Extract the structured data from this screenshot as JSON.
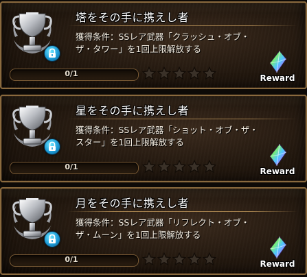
{
  "trophies": [
    {
      "title": "塔をその手に携えし者",
      "description": "獲得条件：SSレア武器「クラッシュ・オブ・ザ・タワー」を1回上限解放する",
      "progress_text": "0/1",
      "progress_fraction": 0,
      "stars_total": 5,
      "stars_filled": 0,
      "reward_label": "Reward"
    },
    {
      "title": "星をその手に携えし者",
      "description": "獲得条件：SSレア武器「ショット・オブ・ザ・スター」を1回上限解放する",
      "progress_text": "0/1",
      "progress_fraction": 0,
      "stars_total": 5,
      "stars_filled": 0,
      "reward_label": "Reward"
    },
    {
      "title": "月をその手に携えし者",
      "description": "獲得条件：SSレア武器「リフレクト・オブ・ザ・ムーン」を1回上限解放する",
      "progress_text": "0/1",
      "progress_fraction": 0,
      "stars_total": 5,
      "stars_filled": 0,
      "reward_label": "Reward"
    }
  ],
  "icons": {
    "trophy": "silver-trophy-icon",
    "lock": "lock-icon",
    "star": "star-icon",
    "reward": "rainbow-crystal-icon"
  },
  "colors": {
    "card_border": "#8a6a3e",
    "star_empty": "#3a3128",
    "star_filled": "#ffd24a",
    "lock_badge": "#1c9ad6"
  }
}
